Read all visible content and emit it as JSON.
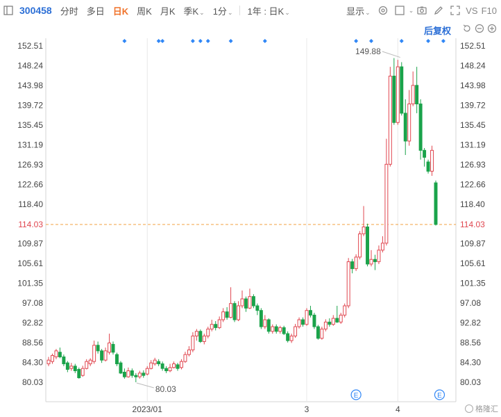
{
  "toolbar": {
    "stock_code": "300458",
    "tabs": [
      "分时",
      "多日",
      "日K",
      "周K",
      "月K"
    ],
    "active_tab": "日K",
    "season_k": "季K",
    "minute_1": "1分",
    "range": "1年 : 日K",
    "display": "显示"
  },
  "adjust_label": "后复权",
  "watermark": "格隆汇",
  "colors": {
    "up": "#e0464f",
    "down": "#1aa34a",
    "current_line": "#f0a040",
    "marker": "#2f86f6",
    "grid": "#e8e8e8"
  },
  "chart_data": {
    "type": "candlestick",
    "y_ticks": [
      "152.51",
      "148.24",
      "143.98",
      "139.72",
      "135.45",
      "131.19",
      "126.93",
      "122.66",
      "118.40",
      "114.03",
      "109.87",
      "105.61",
      "101.35",
      "97.08",
      "92.82",
      "88.56",
      "84.30",
      "80.03"
    ],
    "ylim": [
      80.03,
      152.51
    ],
    "x_labels": [
      {
        "index": 26,
        "text": "2023/01"
      },
      {
        "index": 68,
        "text": "3"
      },
      {
        "index": 92,
        "text": "4"
      }
    ],
    "current_price": "114.03",
    "max_label": "149.88",
    "min_label": "80.03",
    "max_index": 93,
    "min_index": 23,
    "event_marker_label": "E",
    "event_marker_indices": [
      81,
      103
    ],
    "top_marker_indices": [
      20,
      29,
      30,
      38,
      40,
      42,
      48,
      57,
      81,
      85,
      93,
      100,
      104
    ],
    "candles": [
      [
        84.0,
        84.8,
        85.5,
        83.5
      ],
      [
        84.5,
        85.8,
        86.2,
        84.0
      ],
      [
        85.5,
        86.8,
        87.2,
        85.0
      ],
      [
        86.5,
        85.5,
        87.5,
        85.2
      ],
      [
        85.5,
        84.0,
        86.0,
        83.5
      ],
      [
        84.2,
        82.8,
        84.6,
        82.2
      ],
      [
        83.0,
        83.5,
        84.2,
        82.5
      ],
      [
        83.5,
        82.5,
        84.0,
        82.0
      ],
      [
        82.8,
        81.0,
        83.2,
        80.8
      ],
      [
        81.5,
        83.0,
        83.6,
        81.2
      ],
      [
        83.0,
        84.5,
        85.0,
        82.8
      ],
      [
        84.0,
        84.8,
        85.2,
        83.5
      ],
      [
        84.5,
        88.0,
        89.0,
        84.0
      ],
      [
        88.0,
        86.8,
        88.8,
        86.2
      ],
      [
        86.8,
        84.8,
        87.2,
        84.2
      ],
      [
        84.8,
        86.8,
        87.5,
        84.5
      ],
      [
        86.5,
        88.5,
        90.5,
        86.0
      ],
      [
        88.2,
        86.5,
        88.8,
        86.0
      ],
      [
        86.0,
        84.0,
        86.4,
        83.5
      ],
      [
        84.2,
        82.0,
        84.6,
        81.8
      ],
      [
        82.2,
        81.2,
        83.0,
        80.8
      ],
      [
        81.2,
        82.5,
        83.2,
        81.0
      ],
      [
        82.5,
        81.5,
        83.0,
        81.0
      ],
      [
        81.5,
        81.2,
        82.0,
        80.03
      ],
      [
        81.2,
        82.0,
        82.5,
        80.8
      ],
      [
        82.0,
        81.5,
        82.6,
        81.0
      ],
      [
        81.8,
        83.0,
        83.5,
        81.5
      ],
      [
        83.0,
        84.2,
        84.8,
        82.8
      ],
      [
        84.0,
        84.8,
        85.3,
        83.6
      ],
      [
        84.5,
        84.0,
        85.0,
        83.5
      ],
      [
        84.0,
        83.0,
        84.5,
        82.5
      ],
      [
        83.0,
        82.5,
        83.5,
        82.0
      ],
      [
        82.5,
        83.2,
        84.0,
        82.2
      ],
      [
        83.2,
        84.0,
        84.5,
        83.0
      ],
      [
        83.8,
        83.0,
        84.2,
        82.5
      ],
      [
        83.2,
        84.5,
        85.0,
        82.8
      ],
      [
        84.5,
        86.0,
        86.6,
        84.2
      ],
      [
        86.0,
        87.0,
        87.8,
        85.6
      ],
      [
        87.0,
        90.0,
        90.8,
        86.5
      ],
      [
        90.0,
        91.0,
        91.5,
        89.0
      ],
      [
        91.0,
        88.8,
        91.4,
        88.5
      ],
      [
        88.8,
        90.0,
        90.5,
        88.2
      ],
      [
        90.0,
        91.5,
        92.0,
        89.5
      ],
      [
        91.5,
        92.5,
        93.5,
        91.0
      ],
      [
        92.5,
        91.8,
        93.2,
        91.2
      ],
      [
        91.8,
        93.5,
        94.2,
        91.5
      ],
      [
        93.5,
        95.2,
        96.0,
        93.0
      ],
      [
        95.2,
        94.0,
        96.2,
        93.5
      ],
      [
        94.0,
        97.0,
        100.5,
        93.8
      ],
      [
        97.0,
        93.5,
        97.5,
        93.0
      ],
      [
        93.5,
        96.5,
        97.5,
        93.2
      ],
      [
        96.5,
        98.0,
        99.8,
        96.0
      ],
      [
        98.0,
        96.0,
        98.5,
        95.2
      ],
      [
        96.0,
        98.5,
        100.2,
        95.8
      ],
      [
        98.5,
        96.5,
        99.0,
        96.0
      ],
      [
        96.5,
        95.5,
        97.0,
        94.5
      ],
      [
        95.5,
        92.0,
        96.0,
        91.5
      ],
      [
        92.0,
        93.5,
        94.5,
        91.5
      ],
      [
        93.5,
        91.0,
        93.8,
        90.5
      ],
      [
        91.0,
        92.0,
        92.5,
        90.5
      ],
      [
        92.0,
        91.0,
        92.5,
        90.5
      ],
      [
        91.0,
        91.8,
        92.2,
        90.5
      ],
      [
        91.8,
        90.5,
        92.2,
        90.2
      ],
      [
        90.5,
        89.0,
        91.0,
        88.6
      ],
      [
        89.0,
        90.0,
        90.5,
        88.5
      ],
      [
        90.0,
        92.0,
        92.6,
        89.6
      ],
      [
        92.0,
        93.5,
        94.0,
        91.6
      ],
      [
        93.5,
        92.5,
        94.0,
        92.0
      ],
      [
        92.5,
        95.5,
        96.0,
        92.2
      ],
      [
        95.5,
        94.5,
        96.5,
        94.0
      ],
      [
        94.5,
        92.0,
        95.0,
        91.5
      ],
      [
        92.0,
        89.5,
        92.4,
        89.2
      ],
      [
        89.5,
        91.5,
        92.0,
        89.2
      ],
      [
        91.5,
        93.0,
        93.6,
        91.0
      ],
      [
        93.0,
        92.5,
        93.8,
        92.0
      ],
      [
        92.5,
        93.8,
        94.5,
        92.2
      ],
      [
        93.8,
        93.0,
        96.5,
        92.8
      ],
      [
        93.0,
        94.5,
        95.0,
        92.6
      ],
      [
        94.5,
        96.5,
        97.0,
        94.0
      ],
      [
        96.5,
        106.0,
        106.8,
        96.0
      ],
      [
        106.0,
        104.5,
        106.6,
        103.5
      ],
      [
        104.5,
        107.0,
        107.6,
        104.0
      ],
      [
        107.0,
        112.0,
        112.6,
        106.5
      ],
      [
        112.0,
        113.5,
        118.0,
        111.5
      ],
      [
        113.5,
        105.5,
        114.2,
        105.0
      ],
      [
        105.5,
        106.5,
        108.5,
        105.0
      ],
      [
        106.5,
        106.0,
        107.5,
        104.2
      ],
      [
        106.0,
        108.5,
        109.5,
        105.5
      ],
      [
        108.5,
        110.0,
        111.5,
        108.0
      ],
      [
        110.0,
        127.0,
        132.5,
        109.5
      ],
      [
        127.0,
        146.0,
        148.0,
        126.5
      ],
      [
        146.0,
        136.0,
        149.88,
        135.5
      ],
      [
        136.0,
        148.0,
        149.5,
        135.5
      ],
      [
        148.0,
        138.0,
        149.0,
        137.5
      ],
      [
        138.0,
        132.0,
        141.0,
        129.0
      ],
      [
        132.0,
        140.0,
        143.0,
        131.0
      ],
      [
        140.0,
        144.0,
        147.0,
        139.5
      ],
      [
        144.0,
        140.0,
        148.0,
        138.0
      ],
      [
        140.0,
        130.0,
        141.0,
        128.0
      ],
      [
        130.0,
        128.5,
        130.5,
        126.5
      ],
      [
        127.5,
        125.5,
        128.0,
        125.0
      ],
      [
        125.5,
        130.0,
        131.0,
        124.5
      ],
      [
        123.0,
        114.03,
        123.5,
        113.8
      ]
    ]
  }
}
